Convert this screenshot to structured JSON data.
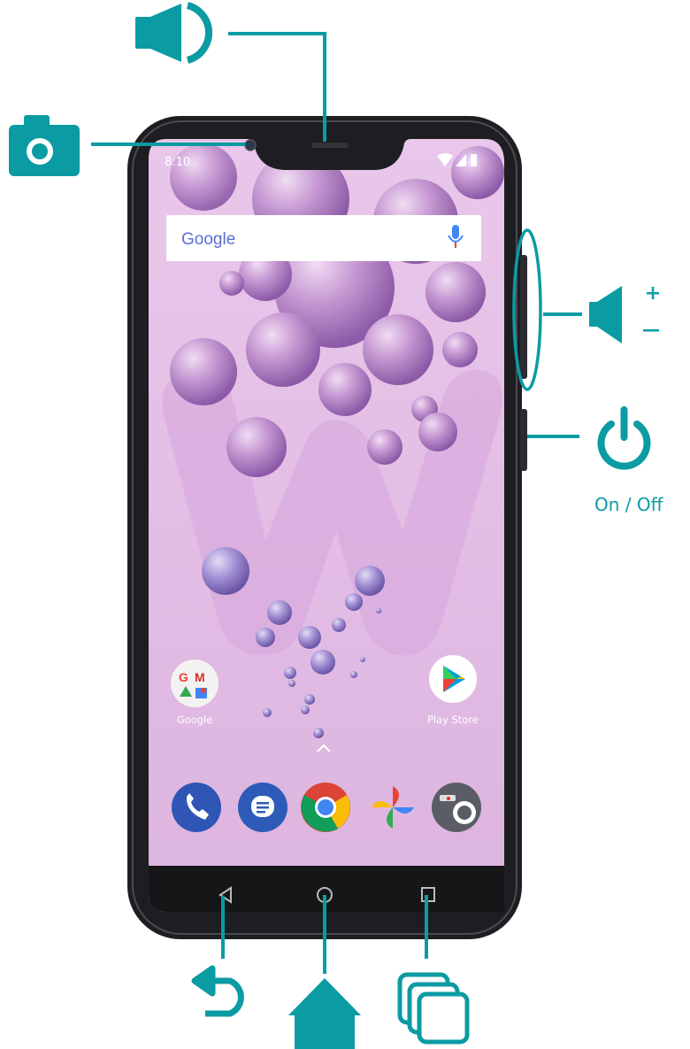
{
  "colors": {
    "accent": "#0b9ba3",
    "phone_body": "#1e1e22",
    "screen_bg": "#e0b8e2"
  },
  "status_bar": {
    "time": "8:10"
  },
  "search_bar": {
    "logo_text": "Google",
    "mic_icon": "mic-icon"
  },
  "home_apps": [
    {
      "label": "Google",
      "icon": "google-folder-icon"
    },
    {
      "label": "Play Store",
      "icon": "play-store-icon"
    }
  ],
  "dock_apps": [
    "phone-icon",
    "messages-icon",
    "chrome-icon",
    "photos-icon",
    "camera-icon"
  ],
  "nav_bar": [
    "back-nav-icon",
    "home-nav-icon",
    "recents-nav-icon"
  ],
  "callouts": {
    "earpiece": "speaker-icon",
    "front_camera": "camera-icon",
    "volume_buttons": "volume-icon",
    "power_button": {
      "icon": "power-icon",
      "label": "On / Off"
    },
    "back_button": "back-arrow-icon",
    "home_button": "home-icon",
    "recents_button": "recent-apps-icon"
  }
}
